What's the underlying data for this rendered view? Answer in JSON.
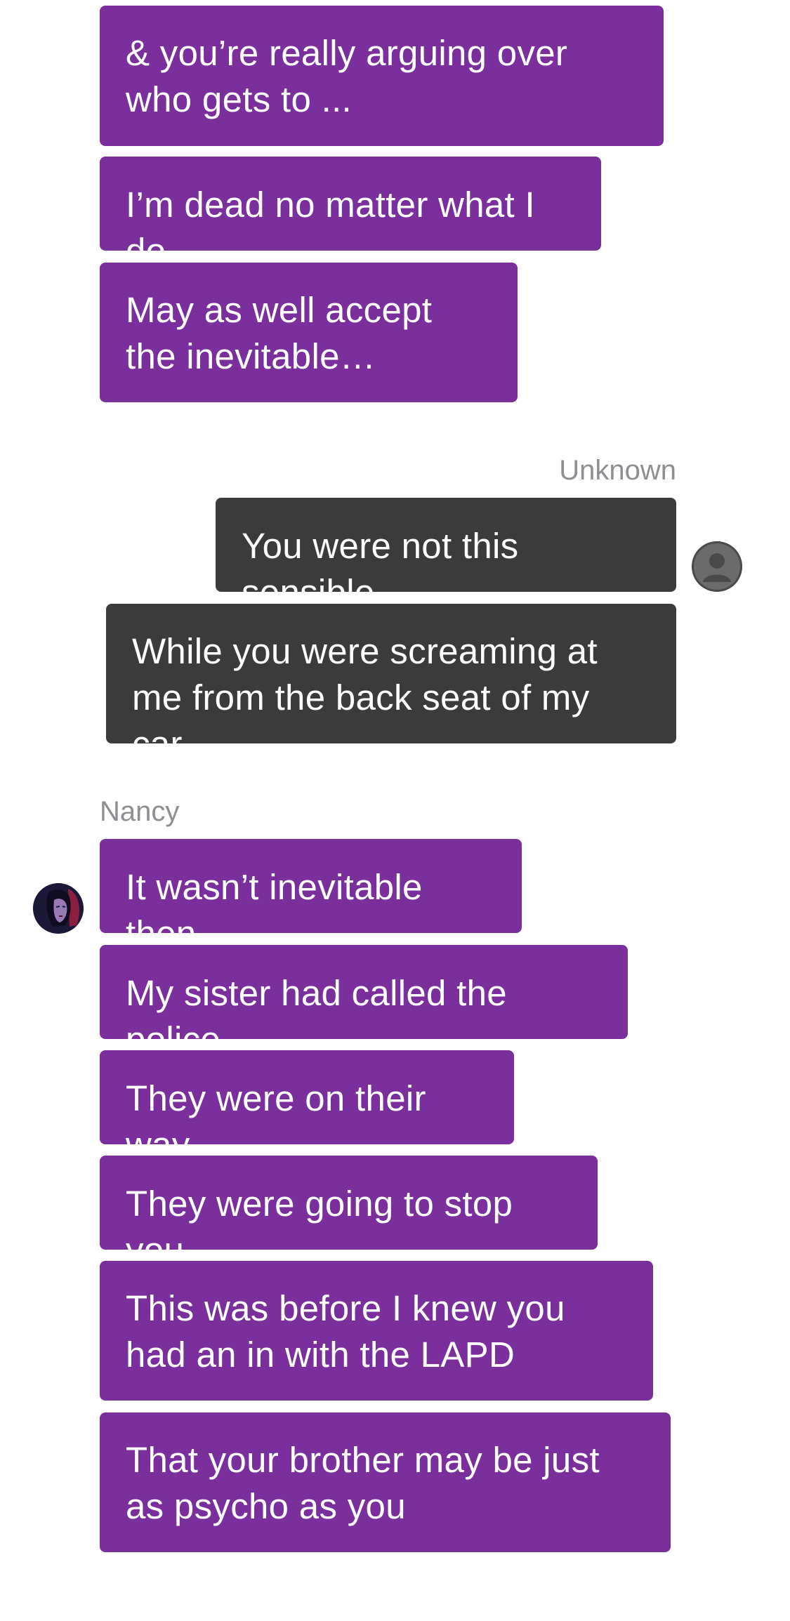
{
  "thread": {
    "group_top": [
      "& you’re really arguing over who gets to ...",
      "I’m dead no matter what I do",
      "May as well accept the inevitable…"
    ],
    "unknown": {
      "sender": "Unknown",
      "messages": [
        "You were not this sensible",
        "While you were screaming at me from the back seat of my car…"
      ],
      "avatar_icon": "person-silhouette-icon"
    },
    "nancy": {
      "sender": "Nancy",
      "messages": [
        "It wasn’t inevitable then",
        "My sister had called the police",
        "They were on their way",
        "They were going to stop you",
        "This was before I knew you had an in with the LAPD",
        "That your brother may be just as psycho as you"
      ],
      "avatar_icon": "nancy-avatar-icon"
    }
  },
  "colors": {
    "purple_bubble": "#7a2f9d",
    "dark_bubble": "#3b3b3b",
    "sender_label": "#8e8e93",
    "background": "#ffffff"
  }
}
